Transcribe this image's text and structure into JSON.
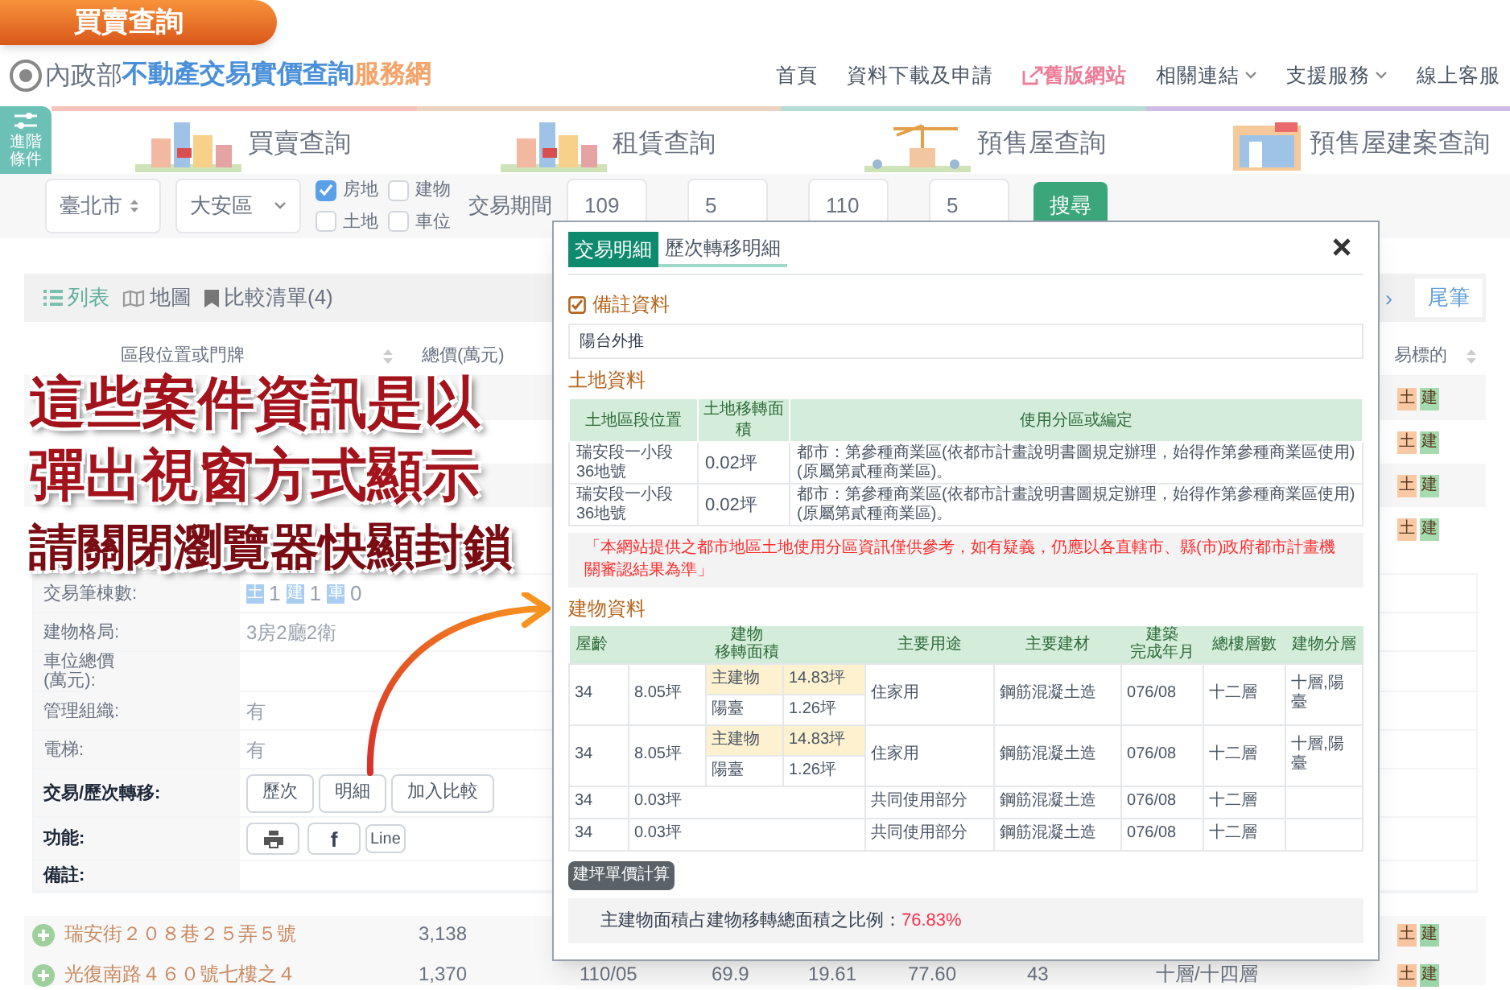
{
  "corner_tag": "買賣查詢",
  "site_logo": {
    "emblem": "內政部",
    "title": "不動產交易實價查詢",
    "suffix": "服務網"
  },
  "nav": [
    {
      "label": "首頁",
      "kind": "link"
    },
    {
      "label": "資料下載及申請",
      "kind": "link"
    },
    {
      "label": "舊版網站",
      "kind": "external"
    },
    {
      "label": "相關連結",
      "kind": "dropdown"
    },
    {
      "label": "支援服務",
      "kind": "dropdown"
    },
    {
      "label": "線上客服",
      "kind": "link"
    }
  ],
  "advanced_button": "進階條件",
  "query_tabs": [
    {
      "label": "買賣查詢",
      "kind": "city",
      "color": "#f6c3bb"
    },
    {
      "label": "租賃查詢",
      "kind": "city",
      "color": "#ecd2c0"
    },
    {
      "label": "預售屋查詢",
      "kind": "crane",
      "color": "#b6dcd6"
    },
    {
      "label": "預售屋建案查詢",
      "kind": "shop",
      "color": "#cdbde6"
    }
  ],
  "filters": {
    "city": "臺北市",
    "district": "大安區",
    "types": [
      {
        "label": "房地",
        "checked": true
      },
      {
        "label": "建物",
        "checked": false
      },
      {
        "label": "土地",
        "checked": false
      },
      {
        "label": "車位",
        "checked": false
      }
    ],
    "period_label": "交易期間",
    "start_year": "109",
    "start_month": "5",
    "end_year": "110",
    "end_month": "5",
    "search": "搜尋"
  },
  "view_toolbar": {
    "views": [
      {
        "label": "列表",
        "kind": "list"
      },
      {
        "label": "地圖",
        "kind": "map"
      },
      {
        "label": "比較清單(4)",
        "kind": "bookmark"
      }
    ],
    "next": "›",
    "last": "尾筆"
  },
  "results": {
    "columns": [
      "區段位置或門牌",
      "總價(萬元)",
      "易標的"
    ],
    "rows": [
      {
        "tags": [
          {
            "label": "土",
            "color": "#f9c9a4"
          },
          {
            "label": "建",
            "color": "#a6dbb0"
          }
        ]
      },
      {
        "tags": [
          {
            "label": "土",
            "color": "#f9c9a4"
          },
          {
            "label": "建",
            "color": "#a6dbb0"
          }
        ]
      },
      {
        "tags": [
          {
            "label": "土",
            "color": "#f9c9a4"
          },
          {
            "label": "建",
            "color": "#a6dbb0"
          }
        ]
      },
      {
        "tags": [
          {
            "label": "土",
            "color": "#f9c9a4"
          },
          {
            "label": "建",
            "color": "#a6dbb0"
          }
        ]
      }
    ]
  },
  "detail": [
    {
      "label": "交易筆棟數:",
      "kind": "counts",
      "counts": [
        {
          "tag": "土",
          "value": "1"
        },
        {
          "tag": "建",
          "value": "1"
        },
        {
          "tag": "車",
          "value": "0"
        }
      ]
    },
    {
      "label": "建物格局:",
      "kind": "value",
      "value": "3房2廳2衛"
    },
    {
      "label": "車位總價\n(萬元):",
      "kind": "value"
    },
    {
      "label": "管理組織:",
      "kind": "value",
      "value": "有"
    },
    {
      "label": "電梯:",
      "kind": "value",
      "value": "有"
    },
    {
      "label": "交易/歷次轉移:",
      "kind": "actions",
      "buttons": [
        "歷次",
        "明細",
        "加入比較"
      ]
    },
    {
      "label": "功能:",
      "kind": "share",
      "buttons": [
        {
          "kind": "print"
        },
        {
          "kind": "facebook",
          "label": "f"
        },
        {
          "kind": "line",
          "label": "Line"
        }
      ]
    },
    {
      "label": "備註:",
      "kind": "note"
    }
  ],
  "more_rows": [
    {
      "address": "瑞安街２０８巷２５弄５號",
      "price": "3,138",
      "tags": [
        {
          "label": "土",
          "color": "#f7c59f"
        },
        {
          "label": "建",
          "color": "#9ed5a8"
        }
      ]
    },
    {
      "address": "光復南路４６０號七樓之４",
      "price": "1,370",
      "cells": [
        "110/05",
        "69.9",
        "19.61",
        "77.60",
        "43",
        "十層/十四層"
      ],
      "tags": [
        {
          "label": "土",
          "color": "#f7c59f"
        },
        {
          "label": "建",
          "color": "#9ed5a8"
        }
      ]
    }
  ],
  "modal": {
    "tabs": [
      {
        "label": "交易明細",
        "selected": true
      },
      {
        "label": "歷次轉移明細",
        "selected": false
      }
    ],
    "remarks": {
      "title": "備註資料",
      "text": "陽台外推"
    },
    "land": {
      "title": "土地資料",
      "columns": [
        "土地區段位置",
        "土地移轉面積",
        "使用分區或編定"
      ],
      "rows": [
        [
          "瑞安段一小段36地號",
          "0.02坪",
          "都市：第參種商業區(依都市計畫說明書圖規定辦理，始得作第參種商業區使用)(原屬第貳種商業區)。"
        ],
        [
          "瑞安段一小段36地號",
          "0.02坪",
          "都市：第參種商業區(依都市計畫說明書圖規定辦理，始得作第參種商業區使用)(原屬第貳種商業區)。"
        ]
      ],
      "notice": "「本網站提供之都市地區土地使用分區資訊僅供參考，如有疑義，仍應以各直轄市、縣(市)政府都市計畫機關審認結果為準」"
    },
    "building": {
      "title": "建物資料",
      "columns": [
        "屋齡",
        [
          "建物",
          "移轉面積"
        ],
        "主要用途",
        "主要建材",
        [
          "建築",
          "完成年月"
        ],
        "總樓層數",
        "建物分層"
      ],
      "rows": [
        {
          "age": "34",
          "area": "8.05坪",
          "parts": [
            {
              "name": "主建物",
              "area": "14.83坪",
              "main": true
            },
            {
              "name": "陽臺",
              "area": "1.26坪",
              "main": false
            }
          ],
          "use": "住家用",
          "material": "鋼筋混凝土造",
          "completed": "076/08",
          "floors": "十二層",
          "levels": "十層,陽臺"
        },
        {
          "age": "34",
          "area": "8.05坪",
          "parts": [
            {
              "name": "主建物",
              "area": "14.83坪",
              "main": true
            },
            {
              "name": "陽臺",
              "area": "1.26坪",
              "main": false
            }
          ],
          "use": "住家用",
          "material": "鋼筋混凝土造",
          "completed": "076/08",
          "floors": "十二層",
          "levels": "十層,陽臺"
        },
        {
          "age": "34",
          "area": "0.03坪",
          "use": "共同使用部分",
          "material": "鋼筋混凝土造",
          "completed": "076/08",
          "floors": "十二層"
        },
        {
          "age": "34",
          "area": "0.03坪",
          "use": "共同使用部分",
          "material": "鋼筋混凝土造",
          "completed": "076/08",
          "floors": "十二層"
        }
      ]
    },
    "calc_button": "建坪單價計算",
    "ratio": {
      "label": "主建物面積占建物移轉總面積之比例：",
      "value": "76.83%"
    }
  },
  "callout": [
    {
      "text": "這些案件資訊是以",
      "kind": "headline"
    },
    {
      "text": "彈出視窗方式顯示",
      "kind": "headline"
    },
    {
      "text": "請關閉瀏覽器快顯封鎖",
      "kind": "emphasis"
    }
  ]
}
